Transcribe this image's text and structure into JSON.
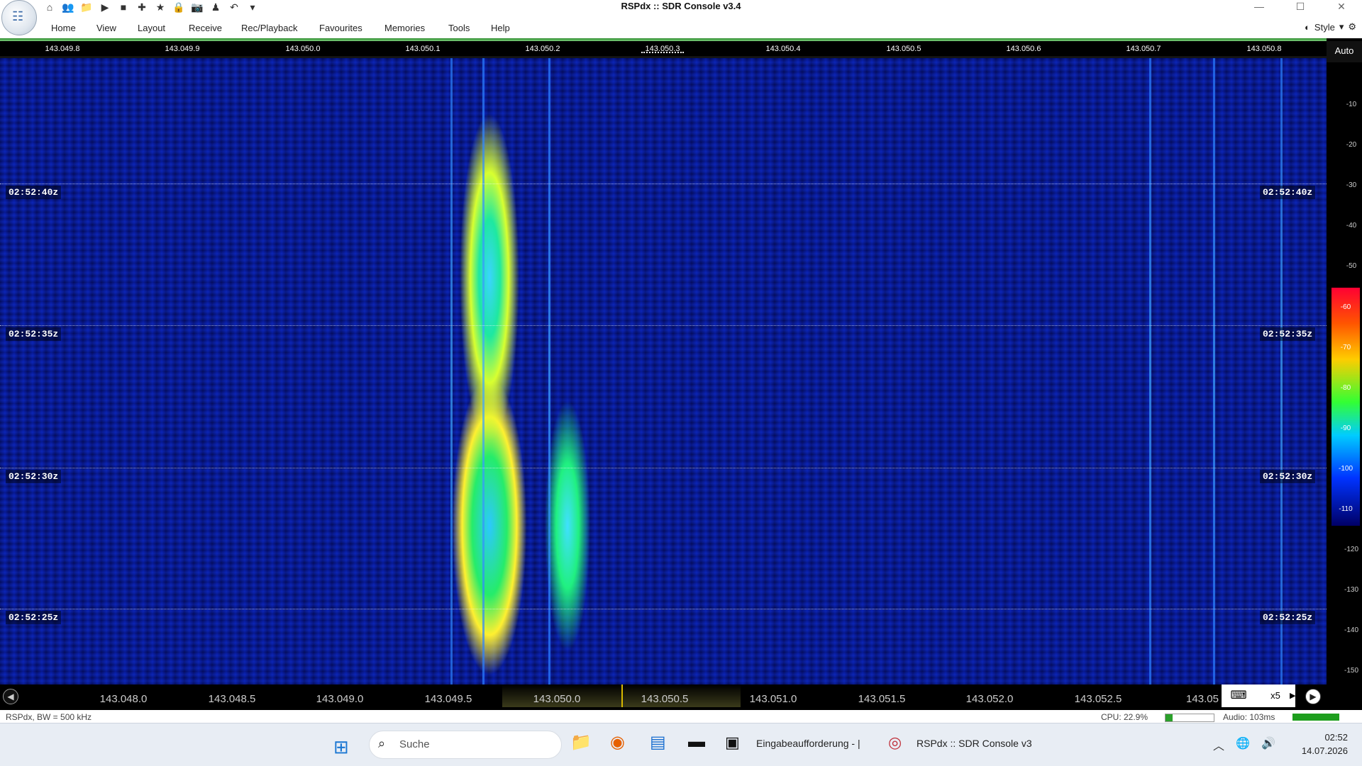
{
  "window": {
    "title": "RSPdx :: SDR Console v3.4",
    "minimize": "—",
    "maximize": "☐",
    "close": "✕"
  },
  "qat_icons": [
    "home-icon",
    "users-icon",
    "folder-icon",
    "play-icon",
    "stop-icon",
    "compass-icon",
    "star-icon",
    "lock-icon",
    "camera-icon",
    "person-icon",
    "undo-icon",
    "dropdown-icon"
  ],
  "menu": {
    "items": [
      "Home",
      "View",
      "Layout",
      "Receive",
      "Rec/Playback",
      "Favourites",
      "Memories",
      "Tools",
      "Help"
    ],
    "style": "Style"
  },
  "top_freq": [
    "143.049.8",
    "143.049.9",
    "143.050.0",
    "143.050.1",
    "143.050.2",
    "143.050.3",
    "143.050.4",
    "143.050.5",
    "143.050.6",
    "143.050.7",
    "143.050.8"
  ],
  "scale": {
    "auto": "Auto",
    "ticks": [
      "-10",
      "-20",
      "-30",
      "-40",
      "-50",
      "-60",
      "-70",
      "-80",
      "-90",
      "-100",
      "-110",
      "-120",
      "-130",
      "-140",
      "-150"
    ]
  },
  "time_labels": [
    "02:52:40z",
    "02:52:35z",
    "02:52:30z",
    "02:52:25z"
  ],
  "bottom_freq": [
    "143.048.0",
    "143.048.5",
    "143.049.0",
    "143.049.5",
    "143.050.0",
    "143.050.5",
    "143.051.0",
    "143.051.5",
    "143.052.0",
    "143.052.5",
    "143.05"
  ],
  "zoom": "x5",
  "status": {
    "left": "RSPdx, BW = 500 kHz",
    "cpu": "CPU: 22.9%",
    "cpu_fraction": 0.15,
    "audio": "Audio: 103ms"
  },
  "taskbar": {
    "search_placeholder": "Suche",
    "cmd_label": "Eingabeaufforderung - |",
    "sdr_label": "RSPdx :: SDR Console v3",
    "time": "02:52",
    "date": "14.07.2026"
  }
}
